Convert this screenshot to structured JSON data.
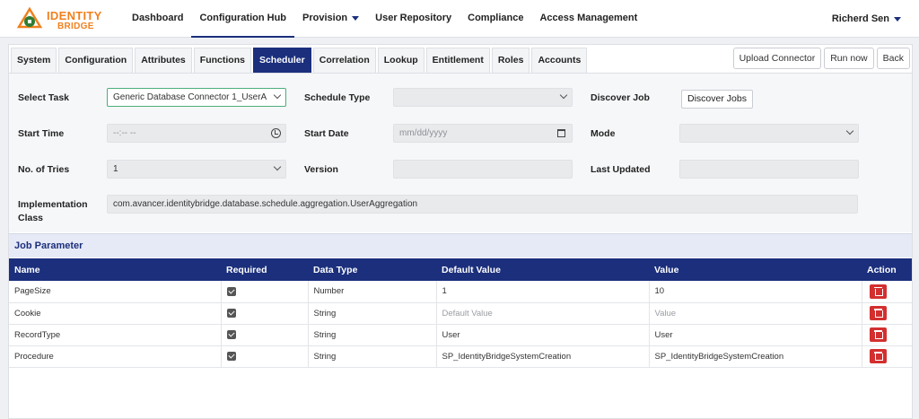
{
  "logo": {
    "line1": "IDENTITY",
    "line2": "BRIDGE"
  },
  "nav": {
    "items": [
      {
        "label": "Dashboard"
      },
      {
        "label": "Configuration Hub"
      },
      {
        "label": "Provision"
      },
      {
        "label": "User Repository"
      },
      {
        "label": "Compliance"
      },
      {
        "label": "Access Management"
      }
    ],
    "user": "Richerd Sen"
  },
  "tabs": [
    "System",
    "Configuration",
    "Attributes",
    "Functions",
    "Scheduler",
    "Correlation",
    "Lookup",
    "Entitlement",
    "Roles",
    "Accounts"
  ],
  "actions": {
    "upload": "Upload Connector",
    "run": "Run now",
    "back": "Back"
  },
  "form": {
    "select_task_label": "Select Task",
    "select_task_value": "Generic Database Connector 1_UserA",
    "schedule_type_label": "Schedule Type",
    "schedule_type_value": "",
    "discover_job_label": "Discover Job",
    "discover_jobs_button": "Discover Jobs",
    "start_time_label": "Start Time",
    "start_time_value": "--:-- --",
    "start_date_label": "Start Date",
    "start_date_value": "mm/dd/yyyy",
    "mode_label": "Mode",
    "mode_value": "",
    "tries_label": "No. of Tries",
    "tries_value": "1",
    "version_label": "Version",
    "version_value": "",
    "last_updated_label": "Last Updated",
    "last_updated_value": "",
    "impl_label_1": "Implementation",
    "impl_label_2": "Class",
    "impl_value": "com.avancer.identitybridge.database.schedule.aggregation.UserAggregation"
  },
  "job_parameter": {
    "title": "Job Parameter",
    "columns": [
      "Name",
      "Required",
      "Data Type",
      "Default Value",
      "Value",
      "Action"
    ],
    "rows": [
      {
        "name": "PageSize",
        "required": true,
        "data_type": "Number",
        "default_value": "1",
        "value": "10"
      },
      {
        "name": "Cookie",
        "required": true,
        "data_type": "String",
        "default_value": "Default Value",
        "value": "Value"
      },
      {
        "name": "RecordType",
        "required": true,
        "data_type": "String",
        "default_value": "User",
        "value": "User"
      },
      {
        "name": "Procedure",
        "required": true,
        "data_type": "String",
        "default_value": "SP_IdentityBridgeSystemCreation",
        "value": "SP_IdentityBridgeSystemCreation"
      }
    ]
  },
  "colors": {
    "primary": "#1b2f7c",
    "brand_orange": "#f0801e",
    "danger": "#d32f2f"
  }
}
